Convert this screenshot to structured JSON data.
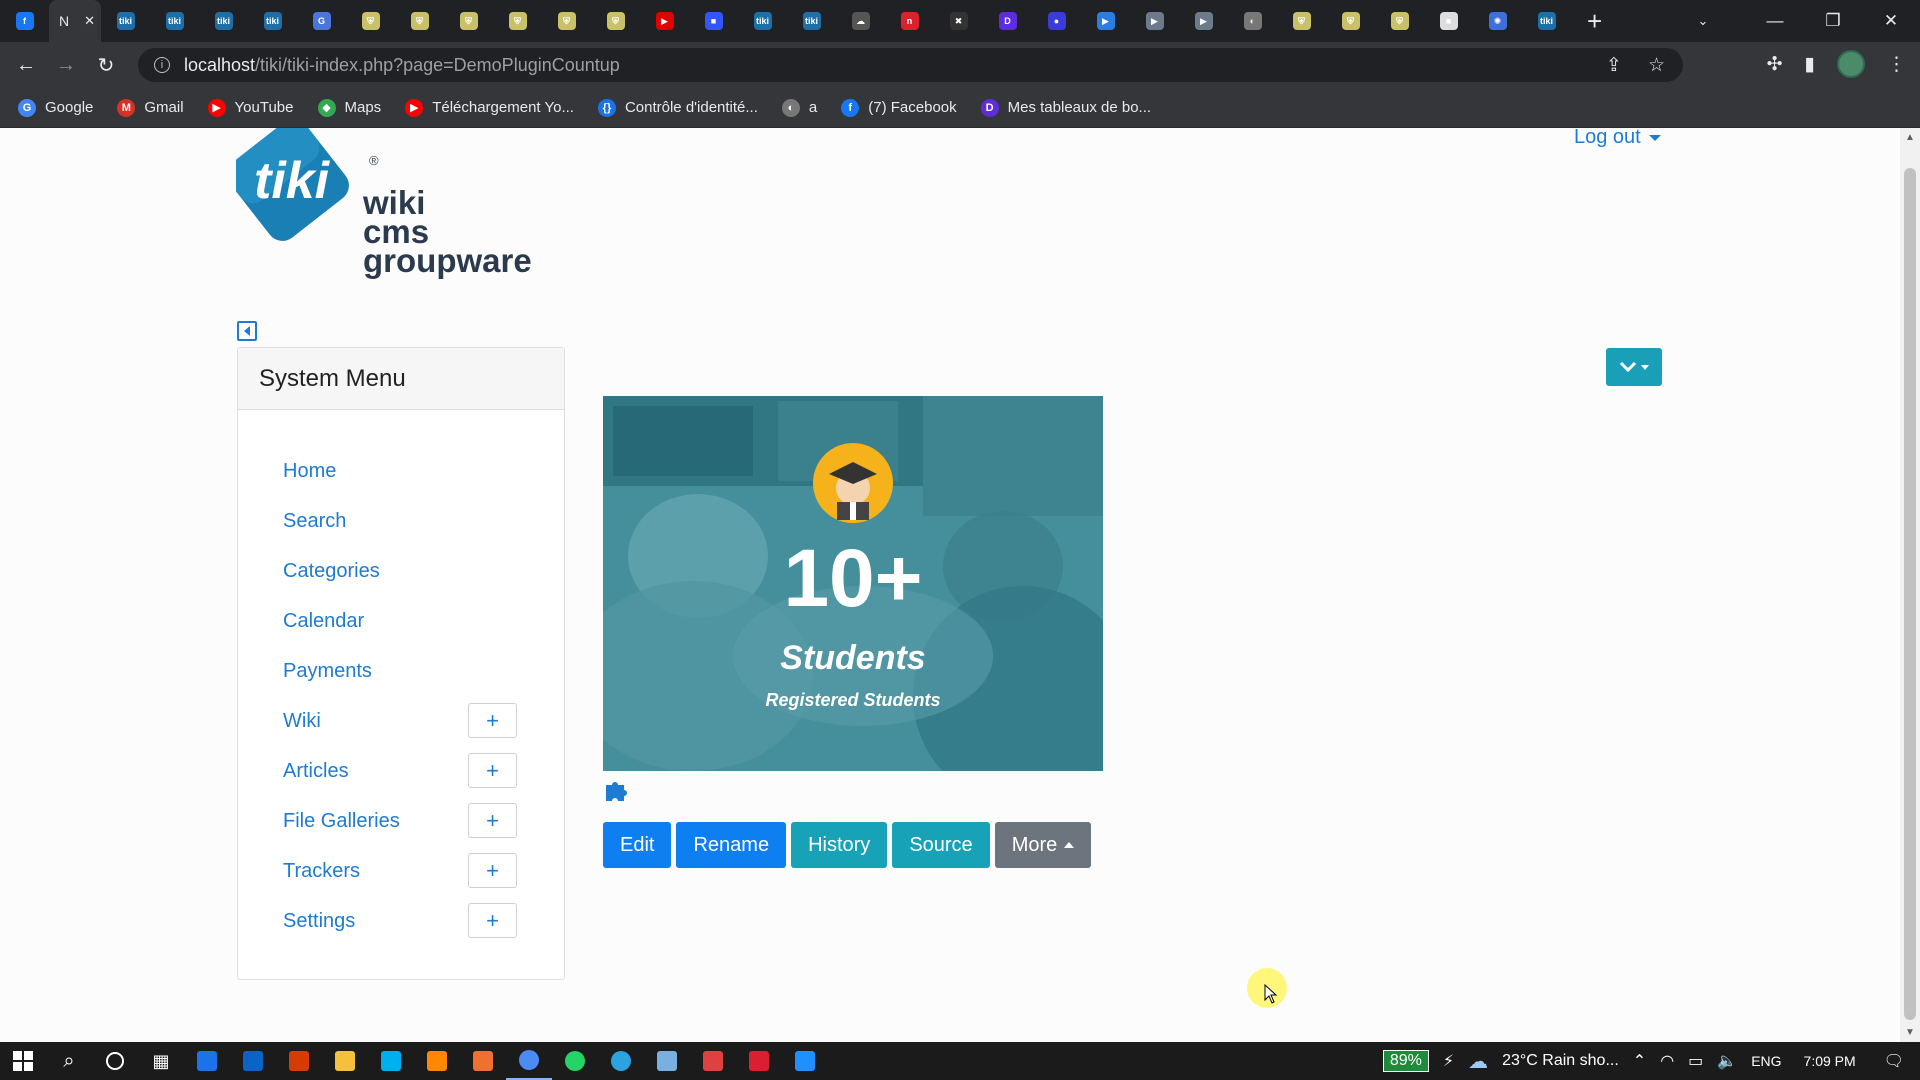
{
  "browser": {
    "active_tab_letter": "N",
    "tab_close": "✕",
    "new_tab": "+",
    "url_host": "localhost",
    "url_path": "/tiki/tiki-index.php?page=DemoPluginCountup",
    "tab_favicons": [
      {
        "bg": "#1877f2",
        "t": "f"
      },
      {
        "bg": "#1e6fa8",
        "t": "tiki"
      },
      {
        "bg": "#1e6fa8",
        "t": "tiki"
      },
      {
        "bg": "#1e6fa8",
        "t": "tiki"
      },
      {
        "bg": "#1e6fa8",
        "t": "tiki"
      },
      {
        "bg": "#4a76d8",
        "t": "G"
      },
      {
        "bg": "#c9c06a",
        "t": "⛨"
      },
      {
        "bg": "#c9c06a",
        "t": "⛨"
      },
      {
        "bg": "#c9c06a",
        "t": "⛨"
      },
      {
        "bg": "#c9c06a",
        "t": "⛨"
      },
      {
        "bg": "#c9c06a",
        "t": "⛨"
      },
      {
        "bg": "#c9c06a",
        "t": "⛨"
      },
      {
        "bg": "#e00000",
        "t": "▶"
      },
      {
        "bg": "#3355ff",
        "t": "■"
      },
      {
        "bg": "#1e6fa8",
        "t": "tiki"
      },
      {
        "bg": "#1e6fa8",
        "t": "tiki"
      },
      {
        "bg": "#555555",
        "t": "☁"
      },
      {
        "bg": "#d8232a",
        "t": "n"
      },
      {
        "bg": "#333333",
        "t": "✖"
      },
      {
        "bg": "#5e2ddb",
        "t": "D"
      },
      {
        "bg": "#3b3bd9",
        "t": "●"
      },
      {
        "bg": "#2a7de1",
        "t": "▶"
      },
      {
        "bg": "#6b7b8b",
        "t": "▶"
      },
      {
        "bg": "#6b7b8b",
        "t": "▶"
      },
      {
        "bg": "#777777",
        "t": "◐"
      },
      {
        "bg": "#c9c06a",
        "t": "⛨"
      },
      {
        "bg": "#c9c06a",
        "t": "⛨"
      },
      {
        "bg": "#c9c06a",
        "t": "⛨"
      },
      {
        "bg": "#dddddd",
        "t": "■"
      },
      {
        "bg": "#3f6fd8",
        "t": "✺"
      },
      {
        "bg": "#1e6fa8",
        "t": "tiki"
      }
    ],
    "bookmarks": [
      {
        "label": "Google",
        "icon": "google-icon",
        "color": "#4285f4",
        "glyph": "G"
      },
      {
        "label": "Gmail",
        "icon": "gmail-icon",
        "color": "#d93025",
        "glyph": "M"
      },
      {
        "label": "YouTube",
        "icon": "youtube-icon",
        "color": "#ff0000",
        "glyph": "▶"
      },
      {
        "label": "Maps",
        "icon": "maps-icon",
        "color": "#34a853",
        "glyph": "◆"
      },
      {
        "label": "Téléchargement Yo...",
        "icon": "youtube-icon",
        "color": "#ff0000",
        "glyph": "▶"
      },
      {
        "label": "Contrôle d'identité...",
        "icon": "bracket-icon",
        "color": "#1a73e8",
        "glyph": "{}"
      },
      {
        "label": "a",
        "icon": "globe-icon",
        "color": "#777777",
        "glyph": "◐"
      },
      {
        "label": "(7) Facebook",
        "icon": "facebook-icon",
        "color": "#1877f2",
        "glyph": "f"
      },
      {
        "label": "Mes tableaux de bo...",
        "icon": "dashboard-icon",
        "color": "#5e2ddb",
        "glyph": "D"
      }
    ]
  },
  "page": {
    "logout": "Log out",
    "logo_texts": [
      "tiki",
      "wiki",
      "cms",
      "groupware",
      "®"
    ],
    "system_menu": {
      "title": "System Menu",
      "items": [
        {
          "label": "Home",
          "expandable": false
        },
        {
          "label": "Search",
          "expandable": false
        },
        {
          "label": "Categories",
          "expandable": false
        },
        {
          "label": "Calendar",
          "expandable": false
        },
        {
          "label": "Payments",
          "expandable": false
        },
        {
          "label": "Wiki",
          "expandable": true
        },
        {
          "label": "Articles",
          "expandable": true
        },
        {
          "label": "File Galleries",
          "expandable": true
        },
        {
          "label": "Trackers",
          "expandable": true
        },
        {
          "label": "Settings",
          "expandable": true
        }
      ],
      "plus": "+"
    },
    "countup": {
      "number": "10+",
      "title": "Students",
      "subtitle": "Registered Students"
    },
    "actions": [
      {
        "label": "Edit",
        "style": "blue"
      },
      {
        "label": "Rename",
        "style": "blue"
      },
      {
        "label": "History",
        "style": "teal"
      },
      {
        "label": "Source",
        "style": "teal"
      },
      {
        "label": "More",
        "style": "gray"
      }
    ]
  },
  "taskbar": {
    "battery": "89%",
    "weather": "23°C  Rain sho...",
    "lang": "ENG",
    "time": "7:09 PM",
    "apps": [
      {
        "name": "mail-app-icon",
        "color": "#1a73e8"
      },
      {
        "name": "outlook-icon",
        "color": "#0a64c8"
      },
      {
        "name": "office-icon",
        "color": "#d83b01"
      },
      {
        "name": "file-explorer-icon",
        "color": "#f3c13a"
      },
      {
        "name": "skype-icon",
        "color": "#00aff0"
      },
      {
        "name": "vlc-icon",
        "color": "#ff8800"
      },
      {
        "name": "store-app-icon",
        "color": "#f07030"
      },
      {
        "name": "chrome-icon",
        "color": "#4c8bf5"
      },
      {
        "name": "whatsapp-icon",
        "color": "#25d366"
      },
      {
        "name": "telegram-icon",
        "color": "#2aa3e0"
      },
      {
        "name": "notepad-icon",
        "color": "#7ab0e0"
      },
      {
        "name": "app-red-icon",
        "color": "#e04040"
      },
      {
        "name": "app-red2-icon",
        "color": "#d82030"
      },
      {
        "name": "vscode-icon",
        "color": "#1e90ff"
      }
    ]
  }
}
